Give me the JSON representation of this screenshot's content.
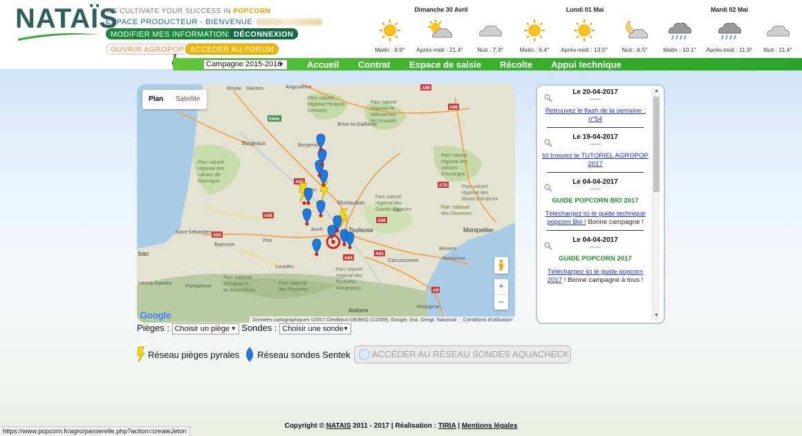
{
  "header": {
    "logo_text": "NATAÏS",
    "tagline_prefix": "WE CULTIVATE YOUR SUCCESS IN",
    "tagline_highlight": "POPCORN",
    "espace": "ESPACE PRODUCTEUR - BIENVENUE",
    "btn_modifier": "MODIFIER MES INFORMATIONS",
    "btn_deconnexion": "DÉCONNEXION",
    "btn_agropop": "OUVRIR AGROPOP",
    "btn_forum": "ACCEDER AU FORUM"
  },
  "weather": {
    "days": [
      {
        "label": "Dimanche 30 Avril"
      },
      {
        "label": "Lundi 01 Mai"
      },
      {
        "label": "Mardi 02 Mai"
      }
    ],
    "slots": [
      {
        "label": "Matin : 8.9°",
        "icon": "sun-icon"
      },
      {
        "label": "Après-midi : 21.4°",
        "icon": "sun-cloud-icon"
      },
      {
        "label": "Nuit : 7.3°",
        "icon": "cloud-icon"
      },
      {
        "label": "Matin : 6.4°",
        "icon": "sun-icon"
      },
      {
        "label": "Après-midi : 13.5°",
        "icon": "sun-icon"
      },
      {
        "label": "Nuit : 6.5°",
        "icon": "moon-cloud-icon"
      },
      {
        "label": "Matin : 10.1°",
        "icon": "rain-icon"
      },
      {
        "label": "Après-midi : 11.9°",
        "icon": "rain-icon"
      },
      {
        "label": "Nuit : 11.4°",
        "icon": "cloud-icon"
      }
    ]
  },
  "nav": {
    "campaign": "Campagne 2015-2016",
    "items": [
      "Accueil",
      "Contrat",
      "Espace de saisie",
      "Récolte",
      "Appui technique"
    ]
  },
  "map": {
    "tab_plan": "Plan",
    "tab_satellite": "Satellite",
    "google": "Google",
    "attribution": "Données cartographiques ©2017 GeoBasis-DE/BKG (©2009), Google, Inst. Geogr. Nacional",
    "terms": "Conditions d'utilisation",
    "places": {
      "royan": "Royan",
      "saintes": "Saintes",
      "angouleme": "Angoulême",
      "limousin": "Parc naturel\nrégional Périgord-\nLimousin",
      "millevaches": "Parc naturel\nrégional de\nMillevaches\nen Limousin",
      "brive": "Brive-la-Gaillarde",
      "bordeaux": "Bordeaux",
      "bergerac": "Bergerac",
      "landes": "Parc naturel\nrégional des\nLandes de\nGascogne",
      "volcans": "Parc naturel\nrégional des\nvolcans\nd'Auvergne",
      "agen": "Agen",
      "montauban": "Montauban",
      "albi": "Albi",
      "causses": "Parc naturel\nrégional des\nGrands Causses",
      "ardeche": "Parc naturel\nrégional des\nMonts d'Ardèche",
      "cevennes": "Parc national\ndes Cévennes",
      "toulouse": "Toulouse",
      "montpellier": "Montpellier",
      "auch": "Auch",
      "beziers": "Béziers",
      "narbonne": "Narbonne",
      "carcassonne": "Carcassonne",
      "sebastien": "Saint-Sébastien",
      "bayonne": "Bayonne",
      "pau": "Pau",
      "lourdes": "Lourdes",
      "gasteiz": "Vitoria-Gasteiz",
      "pamplona": "Pampelune",
      "ordesa": "Parc national\nd'Ordesa et\ndu Mont-Perdu",
      "pyrenees": "Parc national\ndes Pyrénées",
      "ariegeoises": "Parc naturel\nrégional des\nPyrénées\nAriégeoises",
      "andorre": "Andorre",
      "perpignan": "Perpignan",
      "bao": "bao"
    },
    "roads": [
      "E606",
      "A89",
      "A89",
      "A75",
      "A62",
      "A75",
      "A65",
      "A68",
      "A63",
      "A75",
      "A61",
      "A64",
      "A9"
    ]
  },
  "news": [
    {
      "date": "Le 20-04-2017",
      "dash": "------",
      "link": "Retrouvez le flash de la semaine : n°54",
      "after": "",
      "green": ""
    },
    {
      "date": "Le 19-04-2017",
      "dash": "------",
      "link": "Ici trouvez le TUTORIEL AGROPOP 2017",
      "after": "",
      "green": ""
    },
    {
      "date": "Le 04-04-2017",
      "dash": "------",
      "green": "GUIDE POPCORN BIO 2017",
      "link": "Téléchargez ici le guide technique popcorn Bio !",
      "after": " Bonne campagne !"
    },
    {
      "date": "Le 04-04-2017",
      "dash": "------",
      "green": "GUIDE POPCORN 2017",
      "link": "Téléchargez ici le guide popcorn 2017",
      "after": " ! Bonne campagne à tous !"
    }
  ],
  "filters": {
    "pieges_label": "Pièges :",
    "pieges_select": "Choisir un piège",
    "sondes_label": "Sondes :",
    "sondes_select": "Choisir une sonde"
  },
  "legend": {
    "pyrales": "Réseau pièges pyrales",
    "sentek": "Réseau sondes Sentek",
    "aquacheck": "ACCÉDER AU RÉSEAU SONDES AQUACHECK"
  },
  "footer": {
    "copy": "Copyright ©",
    "natais": "NATAIS",
    "years": " 2011 - 2017 | Réalisation : ",
    "tiria": "TIRIA",
    "sep": " | ",
    "mentions": "Mentions légales"
  },
  "status_url": "https://www.popcorn.fr/agro/passerelle.php?action=createJeton",
  "colors": {
    "nav_green": "#3fb22f",
    "brand_teal": "#2d5f5b",
    "link_blue": "#1a2fc4",
    "pin_blue": "#1f7ae0",
    "pin_yellow": "#f5d800"
  }
}
